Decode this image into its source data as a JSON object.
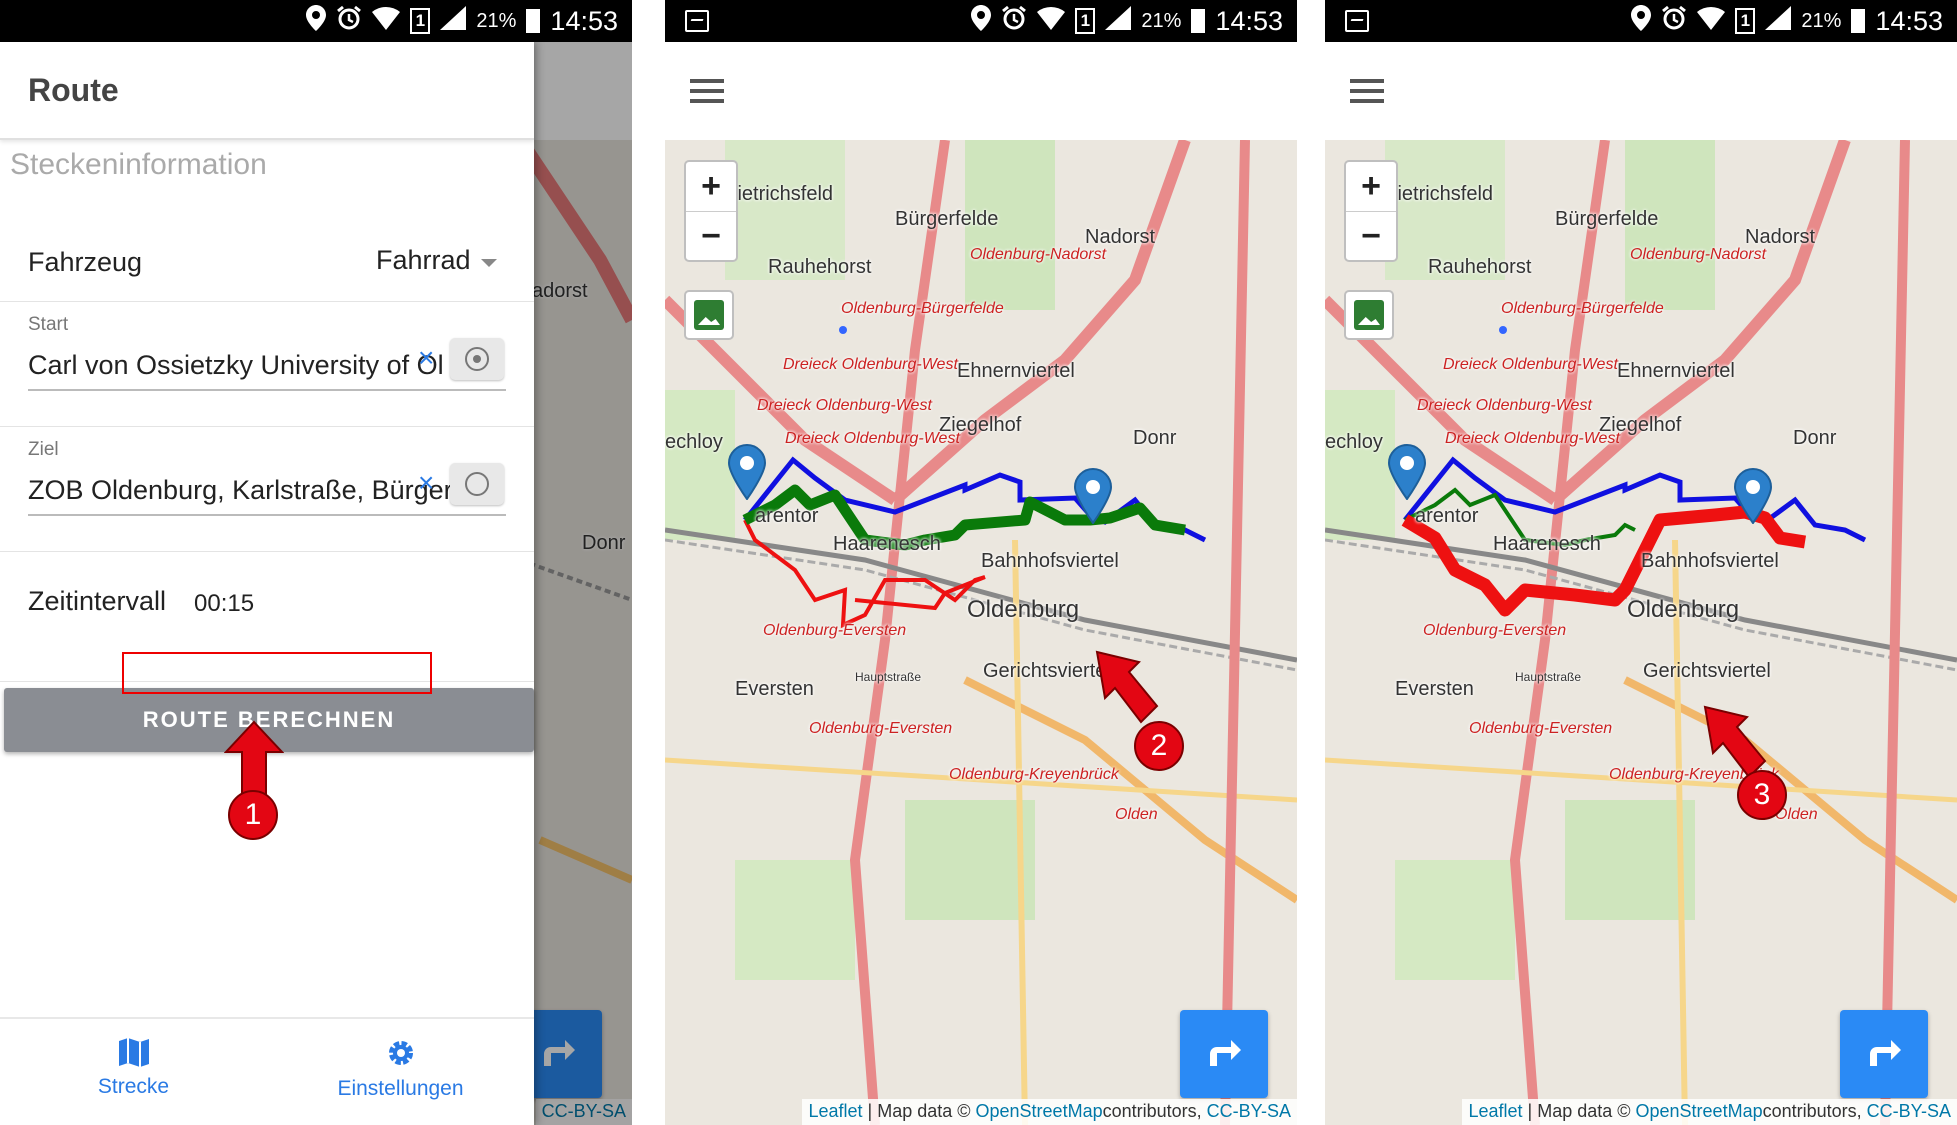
{
  "status_bar": {
    "battery_percent": "21%",
    "time": "14:53",
    "sim_label": "1"
  },
  "drawer": {
    "title": "Route",
    "section_title": "Steckeninformation",
    "vehicle": {
      "label": "Fahrzeug",
      "value": "Fahrrad"
    },
    "start": {
      "label": "Start",
      "value": "Carl von Ossietzky University of Ol",
      "clear": "×"
    },
    "destination": {
      "label": "Ziel",
      "value": "ZOB Oldenburg, Karlstraße, Bürger",
      "clear": "×"
    },
    "time_interval": {
      "label": "Zeitintervall",
      "value": "00:15"
    },
    "calculate_button": "ROUTE BERECHNEN",
    "bottom_nav": [
      {
        "label": "Strecke",
        "icon": "map-icon"
      },
      {
        "label": "Einstellungen",
        "icon": "gear-icon"
      }
    ]
  },
  "map": {
    "zoom_in": "+",
    "zoom_out": "−",
    "labels": {
      "dietrichsfeld": "Dietrichsfeld",
      "buergerfelde": "Bürgerfelde",
      "nadorst": "Nadorst",
      "rauhehorst": "Rauhehorst",
      "ehnernviertel": "Ehnernviertel",
      "ziegelhof": "Ziegelhof",
      "wechloy": "echloy",
      "donnerschwee": "Donr",
      "haarentor": "arentor",
      "haarenesch": "Haarenesch",
      "bahnhofsviertel": "Bahnhofsviertel",
      "oldenburg": "Oldenburg",
      "gerichtsviertel": "Gerichtsviertel",
      "eversten": "Eversten",
      "hauptstrasse": "Hauptstraße",
      "rail_nadorst": "Oldenburg-Nadorst",
      "rail_buergerfelde": "Oldenburg-Bürgerfelde",
      "rail_dreieck1": "Dreieck Oldenburg-West",
      "rail_dreieck2": "Dreieck Oldenburg-West",
      "rail_dreieck3": "Dreieck Oldenburg-West",
      "rail_eversten1": "Oldenburg-Eversten",
      "rail_eversten2": "Oldenburg-Eversten",
      "rail_kreyenbrueck": "Oldenburg-Kreyenbrück",
      "rail_olden": "Olden",
      "p1_dorst": "adorst",
      "p1_donr": "Donr"
    },
    "attribution": {
      "leaflet": "Leaflet",
      "sep1": " | Map data © ",
      "osm": "OpenStreetMap",
      "contrib": "contributors, ",
      "license": "CC-BY-SA"
    }
  },
  "routes": {
    "colors": {
      "blue": "#1010e0",
      "green": "#0a7a0a",
      "red": "#ee1111"
    }
  },
  "annotations": {
    "step1": "1",
    "step2": "2",
    "step3": "3"
  }
}
